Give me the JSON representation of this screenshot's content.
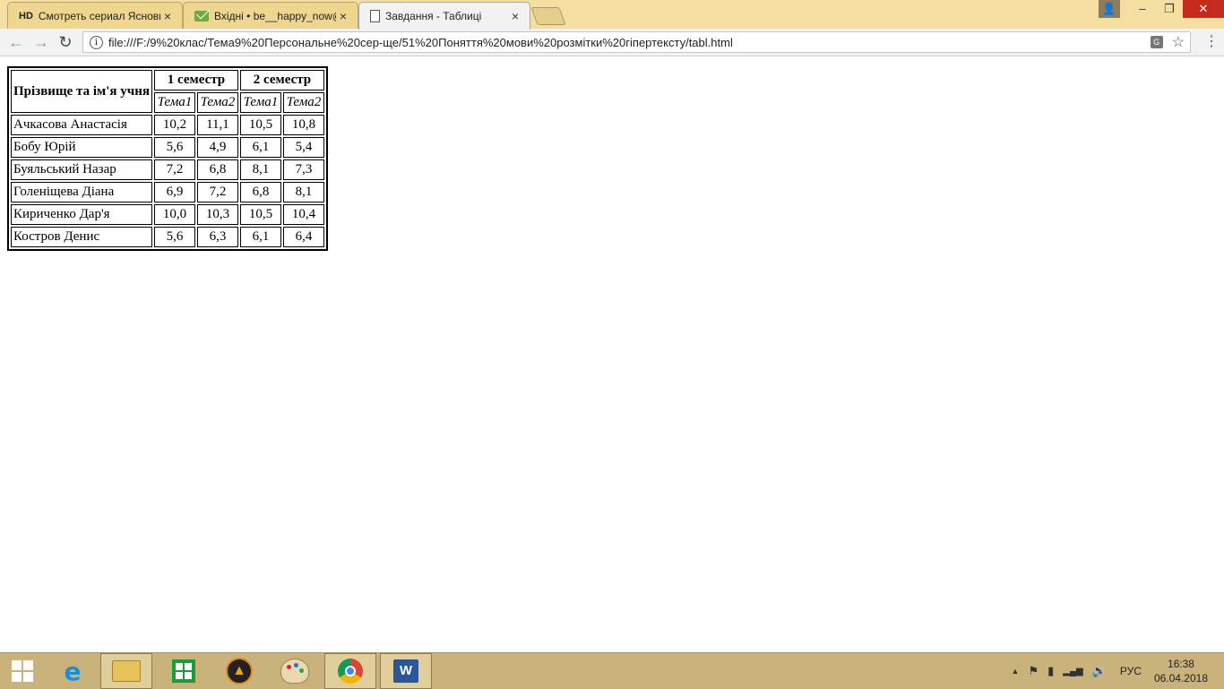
{
  "browser": {
    "tabs": [
      {
        "icon": "hd-icon",
        "icon_text": "HD",
        "title": "Смотреть сериал Ясновидец",
        "close": "×"
      },
      {
        "icon": "mail-icon",
        "title": "Вхідні • be__happy_now@",
        "close": "×"
      },
      {
        "icon": "doc-icon",
        "title": "Завдання - Таблиці",
        "close": "×"
      }
    ],
    "window_buttons": {
      "user": "👤",
      "minimize": "–",
      "restore": "❐",
      "close": "✕"
    },
    "nav": {
      "back": "←",
      "forward": "→",
      "reload": "↻"
    },
    "url": "file:///F:/9%20клас/Тема9%20Персональне%20сер-ще/51%20Поняття%20мови%20розмітки%20гіпертексту/tabl.html",
    "info_icon": "i",
    "translate_icon": "G",
    "star_icon": "☆",
    "menu_icon": "⋮"
  },
  "table": {
    "header": {
      "name_col": "Прізвище та ім'я учня",
      "semester1": "1 семестр",
      "semester2": "2 семестр",
      "topics": [
        "Тема1",
        "Тема2",
        "Тема1",
        "Тема2"
      ]
    },
    "rows": [
      {
        "name": "Ачкасова Анастасія",
        "values": [
          "10,2",
          "11,1",
          "10,5",
          "10,8"
        ]
      },
      {
        "name": "Бобу Юрій",
        "values": [
          "5,6",
          "4,9",
          "6,1",
          "5,4"
        ]
      },
      {
        "name": "Буяльський Назар",
        "values": [
          "7,2",
          "6,8",
          "8,1",
          "7,3"
        ]
      },
      {
        "name": "Голеніщева Діана",
        "values": [
          "6,9",
          "7,2",
          "6,8",
          "8,1"
        ]
      },
      {
        "name": "Кириченко Дар'я",
        "values": [
          "10,0",
          "10,3",
          "10,5",
          "10,4"
        ]
      },
      {
        "name": "Костров Денис",
        "values": [
          "5,6",
          "6,3",
          "6,1",
          "6,4"
        ]
      }
    ]
  },
  "taskbar": {
    "apps": [
      "start-icon",
      "ie-icon",
      "folder-icon",
      "store-icon",
      "aimp-icon",
      "paint-icon",
      "chrome-icon",
      "word-icon"
    ],
    "word_letter": "W",
    "ie_letter": "e",
    "tray": {
      "chevron": "▲",
      "flag": "⚑",
      "battery": "▮",
      "signal": "▂▄▆",
      "volume": "🔊",
      "lang": "РУС",
      "time": "16:38",
      "date": "06.04.2018"
    }
  }
}
